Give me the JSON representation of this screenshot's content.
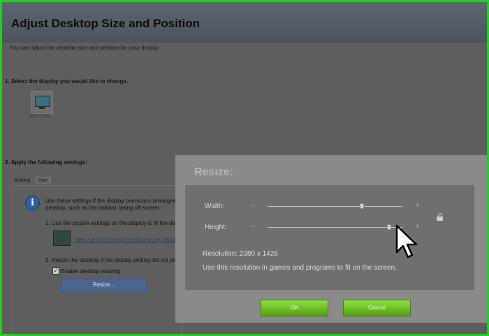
{
  "header": {
    "title": "Adjust Desktop Size and Position",
    "subtitle": "You can adjust the desktop size and position for your display"
  },
  "section1": {
    "heading": "1. Select the display you would like to change.",
    "display_label": "DIGITAL"
  },
  "section2": {
    "heading": "2. Apply the following settings:",
    "tabs": [
      {
        "label": "Scaling"
      },
      {
        "label": "Size"
      }
    ],
    "info_line1": "Use these settings if the display overscans (enlarges)",
    "info_line2": "desktop, such as the taskbar, being off-screen.",
    "step1": "1. Use the picture settings on the display to fit the de",
    "help_link": "Help me find the right setting on my displ",
    "step2": "2. Resize the desktop if the display setting did not pro",
    "checkbox_label": "Enable desktop resizing",
    "checkbox_checked": true,
    "resize_button": "Resize..."
  },
  "modal": {
    "title": "Resize:",
    "width_label": "Width:",
    "height_label": "Height:",
    "minus": "−",
    "plus": "+",
    "width_level": 0.7,
    "height_level": 0.9,
    "resolution": "Resolution: 2380 x 1426",
    "hint": "Use this resolution in games and programs to fit on the screen.",
    "ok": "OK",
    "cancel": "Cancel"
  },
  "colors": {
    "frame_border": "#22cc22",
    "button_green": "#6cc022",
    "link": "#2a3d73"
  },
  "icons": [
    "display-icon",
    "info-icon",
    "lock-icon",
    "cursor-arrow-icon",
    "check-icon"
  ]
}
